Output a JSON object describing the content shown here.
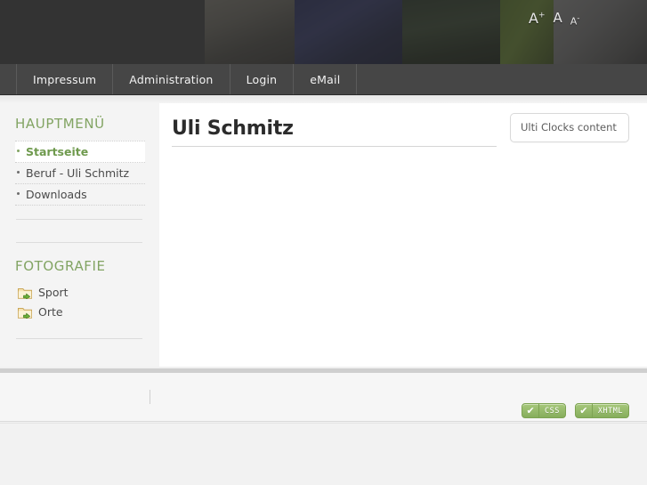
{
  "header": {
    "font_sizer": {
      "increase_label": "A",
      "increase_sup": "+",
      "reset_label": "A",
      "decrease_label": "A",
      "decrease_sup": "-"
    },
    "photos": [
      {
        "name": "water-skier"
      },
      {
        "name": "pole-vault"
      },
      {
        "name": "medal-athlete"
      },
      {
        "name": "smiling-woman"
      },
      {
        "name": "woman-with-glasses"
      }
    ]
  },
  "nav": {
    "items": [
      {
        "label": "Impressum"
      },
      {
        "label": "Administration"
      },
      {
        "label": "Login"
      },
      {
        "label": "eMail"
      }
    ]
  },
  "sidebar": {
    "mainmenu": {
      "title": "HAUPTMENÜ",
      "items": [
        {
          "label": "Startseite",
          "active": true
        },
        {
          "label": "Beruf - Uli Schmitz",
          "active": false
        },
        {
          "label": "Downloads",
          "active": false
        }
      ]
    },
    "photography": {
      "title": "FOTOGRAFIE",
      "items": [
        {
          "label": "Sport",
          "icon": "folder-arrow-icon"
        },
        {
          "label": "Orte",
          "icon": "folder-arrow-icon"
        }
      ]
    }
  },
  "main": {
    "page_title": "Uli Schmitz",
    "clocks_module": {
      "text": "Ulti Clocks content"
    }
  },
  "footer": {
    "badges": [
      {
        "check": "✔",
        "label": "CSS"
      },
      {
        "check": "✔",
        "label": "XHTML"
      }
    ]
  },
  "colors": {
    "accent_green": "#82a463",
    "nav_bg": "#464646",
    "header_bg": "#333333",
    "page_bg": "#f1f1f1",
    "sidebar_bg": "#f4f4f4",
    "content_bg": "#ffffff",
    "badge_green": "#86ad5c"
  }
}
